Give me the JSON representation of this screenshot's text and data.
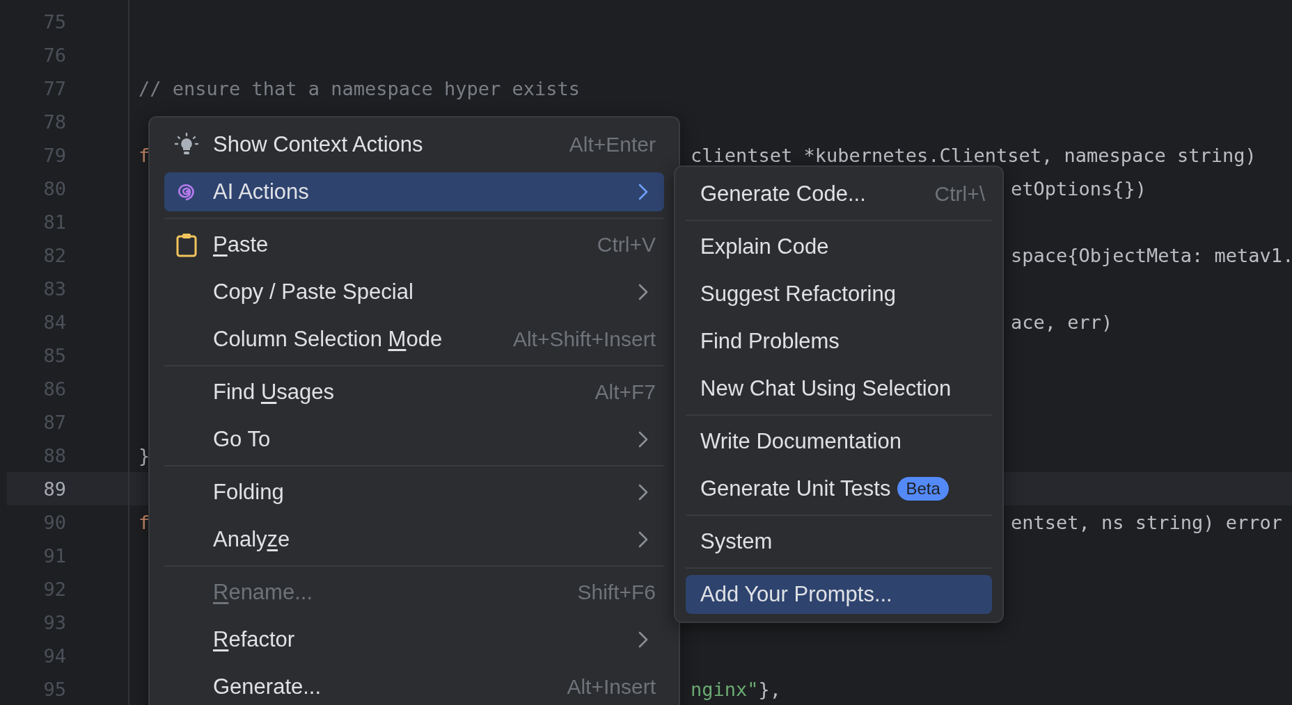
{
  "code_lines": [
    {
      "number": "75",
      "current": false
    },
    {
      "number": "76",
      "current": false
    },
    {
      "number": "77",
      "current": false,
      "left": [
        {
          "text": "// ensure that a namespace hyper exists",
          "kind": "comment"
        }
      ]
    },
    {
      "number": "78",
      "current": false
    },
    {
      "number": "79",
      "current": false,
      "left": [
        {
          "text": "f",
          "kind": "keyword"
        }
      ],
      "right": {
        "kind": "menu",
        "tokens": [
          {
            "text": "clientset *kubernetes.Clientset, namespace string)",
            "kind": "plain"
          }
        ]
      }
    },
    {
      "number": "80",
      "current": false,
      "right": {
        "kind": "submenu",
        "tokens": [
          {
            "text": "etOptions{})",
            "kind": "plain"
          }
        ]
      }
    },
    {
      "number": "81",
      "current": false
    },
    {
      "number": "82",
      "current": false,
      "right": {
        "kind": "submenu",
        "tokens": [
          {
            "text": "space{ObjectMeta: metav1.",
            "kind": "plain"
          }
        ]
      }
    },
    {
      "number": "83",
      "current": false
    },
    {
      "number": "84",
      "current": false,
      "right": {
        "kind": "submenu",
        "tokens": [
          {
            "text": "ace, err)",
            "kind": "plain"
          }
        ]
      }
    },
    {
      "number": "85",
      "current": false
    },
    {
      "number": "86",
      "current": false
    },
    {
      "number": "87",
      "current": false
    },
    {
      "number": "88",
      "current": false,
      "left": [
        {
          "text": "}",
          "kind": "plain"
        }
      ]
    },
    {
      "number": "89",
      "current": true
    },
    {
      "number": "90",
      "current": false,
      "left": [
        {
          "text": "f",
          "kind": "keyword"
        }
      ],
      "right": {
        "kind": "submenu",
        "tokens": [
          {
            "text": "entset, ns string) error",
            "kind": "plain"
          }
        ]
      }
    },
    {
      "number": "91",
      "current": false
    },
    {
      "number": "92",
      "current": false
    },
    {
      "number": "93",
      "current": false
    },
    {
      "number": "94",
      "current": false
    },
    {
      "number": "95",
      "current": false,
      "right": {
        "kind": "menu",
        "tokens": [
          {
            "text": "nginx\"",
            "kind": "string"
          },
          {
            "text": "},",
            "kind": "plain"
          }
        ]
      }
    }
  ],
  "context_menu": {
    "items": [
      {
        "kind": "item",
        "label": [
          {
            "text": "Show Context Actions",
            "underline": false
          }
        ],
        "shortcut": "Alt+Enter",
        "selected": false,
        "disabled": false,
        "submenu": false
      },
      {
        "kind": "item",
        "label": [
          {
            "text": "AI Actions",
            "underline": false
          }
        ],
        "selected": true,
        "disabled": false,
        "submenu": true
      },
      {
        "kind": "separator"
      },
      {
        "kind": "item",
        "label": [
          {
            "text": "P",
            "underline": true
          },
          {
            "text": "aste",
            "underline": false
          }
        ],
        "shortcut": "Ctrl+V",
        "selected": false,
        "disabled": false,
        "submenu": false
      },
      {
        "kind": "item",
        "label": [
          {
            "text": "Copy / Paste Special",
            "underline": false
          }
        ],
        "selected": false,
        "disabled": false,
        "submenu": true
      },
      {
        "kind": "item",
        "label": [
          {
            "text": "Column Selection ",
            "underline": false
          },
          {
            "text": "M",
            "underline": true
          },
          {
            "text": "ode",
            "underline": false
          }
        ],
        "shortcut": "Alt+Shift+Insert",
        "selected": false,
        "disabled": false,
        "submenu": false
      },
      {
        "kind": "separator"
      },
      {
        "kind": "item",
        "label": [
          {
            "text": "Find ",
            "underline": false
          },
          {
            "text": "U",
            "underline": true
          },
          {
            "text": "sages",
            "underline": false
          }
        ],
        "shortcut": "Alt+F7",
        "selected": false,
        "disabled": false,
        "submenu": false
      },
      {
        "kind": "item",
        "label": [
          {
            "text": "Go To",
            "underline": false
          }
        ],
        "selected": false,
        "disabled": false,
        "submenu": true
      },
      {
        "kind": "separator"
      },
      {
        "kind": "item",
        "label": [
          {
            "text": "Folding",
            "underline": false
          }
        ],
        "selected": false,
        "disabled": false,
        "submenu": true
      },
      {
        "kind": "item",
        "label": [
          {
            "text": "Analy",
            "underline": false
          },
          {
            "text": "z",
            "underline": true
          },
          {
            "text": "e",
            "underline": false
          }
        ],
        "selected": false,
        "disabled": false,
        "submenu": true
      },
      {
        "kind": "separator"
      },
      {
        "kind": "item",
        "label": [
          {
            "text": "R",
            "underline": true
          },
          {
            "text": "ename...",
            "underline": false
          }
        ],
        "shortcut": "Shift+F6",
        "selected": false,
        "disabled": true,
        "submenu": false
      },
      {
        "kind": "item",
        "label": [
          {
            "text": "R",
            "underline": true
          },
          {
            "text": "efactor",
            "underline": false
          }
        ],
        "selected": false,
        "disabled": false,
        "submenu": true
      },
      {
        "kind": "item",
        "label": [
          {
            "text": "Generate...",
            "underline": false
          }
        ],
        "shortcut": "Alt+Insert",
        "selected": false,
        "disabled": false,
        "submenu": false
      }
    ]
  },
  "ai_submenu": {
    "items": [
      {
        "kind": "item",
        "label": "Generate Code...",
        "shortcut": "Ctrl+\\",
        "selected": false
      },
      {
        "kind": "separator"
      },
      {
        "kind": "item",
        "label": "Explain Code",
        "selected": false
      },
      {
        "kind": "item",
        "label": "Suggest Refactoring",
        "selected": false
      },
      {
        "kind": "item",
        "label": "Find Problems",
        "selected": false
      },
      {
        "kind": "item",
        "label": "New Chat Using Selection",
        "selected": false
      },
      {
        "kind": "separator"
      },
      {
        "kind": "item",
        "label": "Write Documentation",
        "selected": false
      },
      {
        "kind": "item",
        "label": "Generate Unit Tests",
        "badge": "Beta",
        "selected": false
      },
      {
        "kind": "separator"
      },
      {
        "kind": "item",
        "label": "System",
        "selected": false
      },
      {
        "kind": "separator"
      },
      {
        "kind": "item",
        "label": "Add Your Prompts...",
        "selected": true
      }
    ]
  }
}
